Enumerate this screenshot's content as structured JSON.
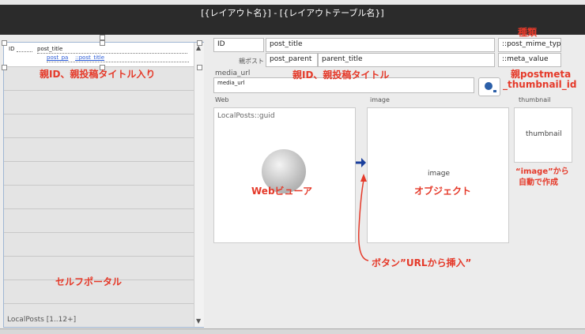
{
  "window": {
    "title": "[{レイアウト名}] - [{レイアウトテーブル名}]"
  },
  "portal": {
    "field_id": "ID",
    "field_post_title": "post_title",
    "field_post_pa": "post_pa",
    "field_post_title_ref": "::post_title",
    "footer_label": "LocalPosts [1..12+]",
    "annotation_top": "親ID、親投稿タイトル入り",
    "annotation_bottom": "セルフポータル"
  },
  "fields": {
    "id": "ID",
    "post_title": "post_title",
    "post_mime_type": "::post_mime_typ",
    "parent_label": "親ポスト",
    "post_parent": "post_parent",
    "parent_title": "parent_title",
    "meta_value": "::meta_value",
    "media_url_label": "media_url",
    "media_url": "media_url"
  },
  "objects": {
    "web_label": "Web",
    "web_content": "LocalPosts::guid",
    "image_label": "image",
    "image_content": "image",
    "thumbnail_label": "thumbnail",
    "thumbnail_content": "thumbnail"
  },
  "annotations": {
    "type": "種類",
    "parent_id_title": "親ID、親投稿タイトル",
    "postmeta_line1": "親postmeta",
    "postmeta_line2": "_thumbnail_id",
    "image_auto_line1": "“image”から",
    "image_auto_line2": "自動で作成",
    "web_viewer": "Webビューア",
    "object": "オブジェクト",
    "button_insert": "ボタン”URLから挿入”"
  }
}
